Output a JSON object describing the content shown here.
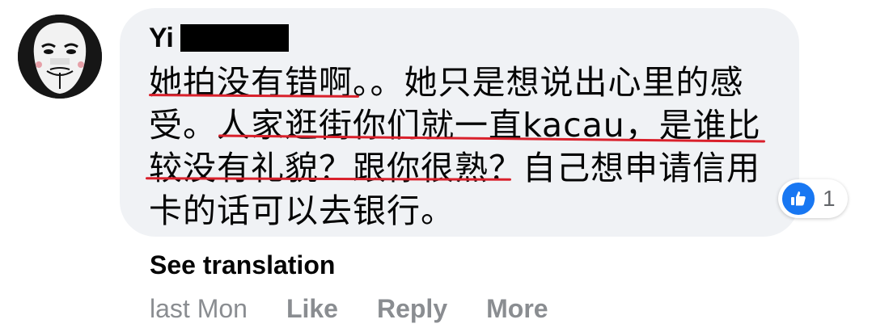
{
  "comment": {
    "author": {
      "name": "Yi",
      "avatar_icon": "mask-avatar-icon"
    },
    "text_lines": [
      "她拍没有错啊。。她只是想说出心里的感",
      "受。人家逛街你们就一直kacau，是谁比",
      "较没有礼貌？跟你很熟？自己想申请信用",
      "卡的话可以去银行。"
    ],
    "reaction": {
      "icon": "like-icon",
      "count": "1",
      "color": "#1877f2"
    },
    "see_translation": "See translation",
    "timestamp": "last Mon",
    "actions": {
      "like": "Like",
      "reply": "Reply",
      "more": "More"
    }
  },
  "colors": {
    "underline": "#d9202b",
    "bubble": "#f0f2f5",
    "muted": "#8a8d91"
  }
}
